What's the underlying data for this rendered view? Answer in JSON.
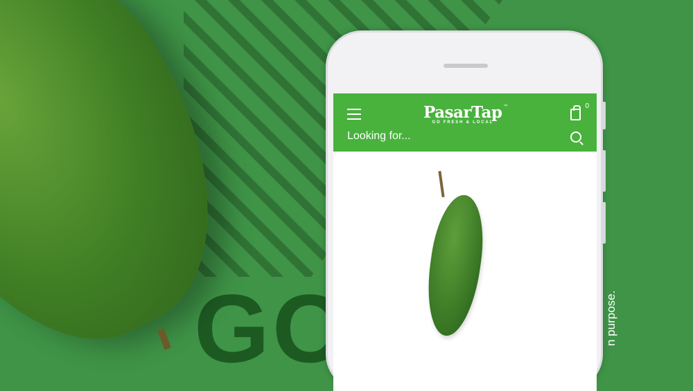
{
  "app": {
    "brand": "PasarTap",
    "tagline": "GO FRESH & LOCAL",
    "tm": "™",
    "cart_count": "0",
    "search_placeholder": "Looking for..."
  },
  "banner": {
    "headline": "GO",
    "side_text": "n purpose."
  },
  "colors": {
    "background": "#3f9447",
    "appbar": "#48b23d",
    "stripes": "#2e6f33"
  }
}
